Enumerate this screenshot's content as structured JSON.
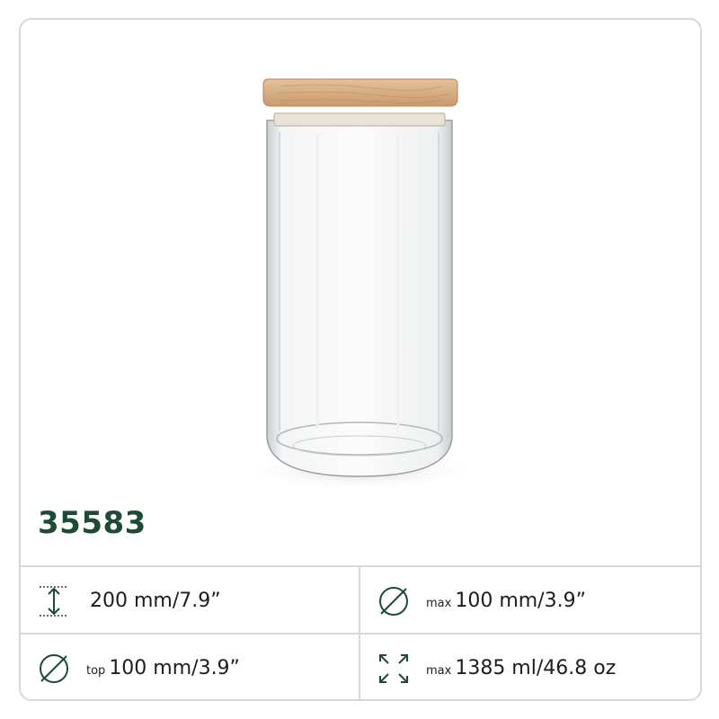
{
  "product": {
    "code": "35583",
    "image": {
      "description_icon": "glass-jar-with-wooden-lid",
      "lid_color": "#d8b08a",
      "glass_color": "#cfd4d6"
    }
  },
  "specs": {
    "height": {
      "icon": "height-arrow-icon",
      "prefix": "",
      "value": "200 mm/7.9”"
    },
    "max_diameter": {
      "icon": "diameter-icon",
      "prefix": "max",
      "value": "100 mm/3.9”"
    },
    "top_diameter": {
      "icon": "diameter-icon",
      "prefix": "top",
      "value": "100 mm/3.9”"
    },
    "capacity": {
      "icon": "expand-arrows-icon",
      "prefix": "max",
      "value": "1385 ml/46.8 oz"
    }
  },
  "colors": {
    "brand_green": "#1f4a36",
    "border": "#d8d8d8",
    "text": "#1d1d1d"
  }
}
